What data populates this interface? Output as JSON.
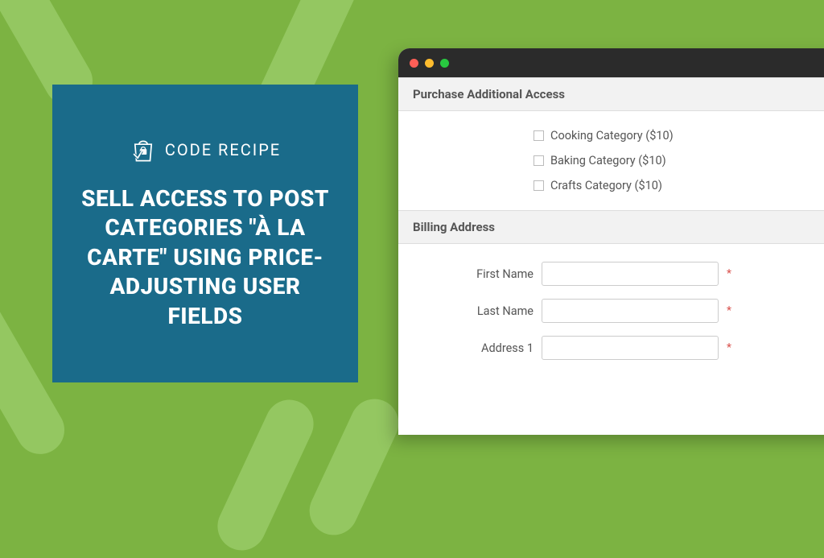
{
  "brand": {
    "logo_text": "CODE RECIPE"
  },
  "headline": "SELL ACCESS TO POST CATEGORIES \"À LA CARTE\" USING PRICE-ADJUSTING USER FIELDS",
  "form": {
    "section1_title": "Purchase Additional Access",
    "options": [
      {
        "label": "Cooking Category ($10)"
      },
      {
        "label": "Baking Category ($10)"
      },
      {
        "label": "Crafts Category ($10)"
      }
    ],
    "section2_title": "Billing Address",
    "fields": {
      "first_name_label": "First Name",
      "last_name_label": "Last Name",
      "address1_label": "Address 1"
    },
    "required_mark": "*"
  }
}
